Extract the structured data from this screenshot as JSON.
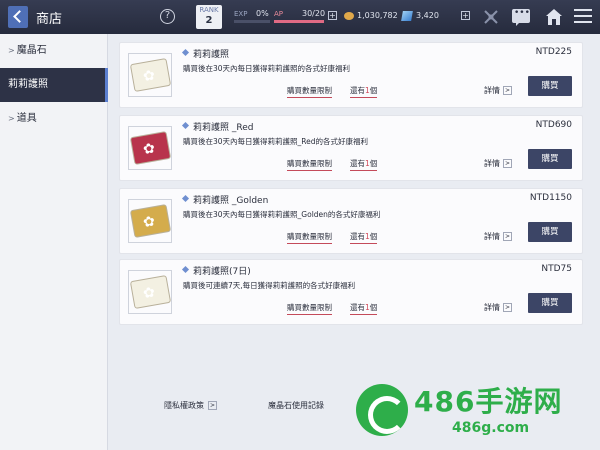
{
  "header": {
    "title": "商店",
    "help_glyph": "?",
    "rank_label": "RANK",
    "rank_value": "2",
    "exp_label": "EXP",
    "exp_value": "0%",
    "exp_progress": 0,
    "ap_label": "AP",
    "ap_value": "30/20",
    "ap_progress": 1,
    "plus_glyph": "+",
    "coins": "1,030,782",
    "gems": "3,420"
  },
  "sidebar": {
    "items": [
      {
        "label": "魔晶石",
        "has_caret": true
      },
      {
        "label": "莉莉護照",
        "has_caret": false,
        "active": true
      },
      {
        "label": "道具",
        "has_caret": true
      }
    ]
  },
  "products": [
    {
      "name": "莉莉護照",
      "price": "NTD225",
      "description": "購買後在30天內每日獲得莉莉護照的各式好康福利",
      "limit_label": "購買數量限制",
      "remaining_prefix": "還有",
      "remaining_count": "1",
      "remaining_suffix": "個",
      "detail_label": "詳情",
      "buy_label": "購買",
      "card_color": "#f3f0e2"
    },
    {
      "name": "莉莉護照 _Red",
      "price": "NTD690",
      "description": "購買後在30天內每日獲得莉莉護照_Red的各式好康福利",
      "limit_label": "購買數量限制",
      "remaining_prefix": "還有",
      "remaining_count": "1",
      "remaining_suffix": "個",
      "detail_label": "詳情",
      "buy_label": "購買",
      "card_color": "#b8344c"
    },
    {
      "name": "莉莉護照 _Golden",
      "price": "NTD1150",
      "description": "購買後在30天內每日獲得莉莉護照_Golden的各式好康福利",
      "limit_label": "購買數量限制",
      "remaining_prefix": "還有",
      "remaining_count": "1",
      "remaining_suffix": "個",
      "detail_label": "詳情",
      "buy_label": "購買",
      "card_color": "#d4ac4c"
    },
    {
      "name": "莉莉護照(7日)",
      "price": "NTD75",
      "description": "購買後可連續7天,每日獲得莉莉護照的各式好康福利",
      "limit_label": "購買數量限制",
      "remaining_prefix": "還有",
      "remaining_count": "1",
      "remaining_suffix": "個",
      "detail_label": "詳情",
      "buy_label": "購買",
      "card_color": "#f3f0e2"
    }
  ],
  "arrow_glyph": ">",
  "footer": {
    "privacy_label": "隱私權政策",
    "gem_usage_label": "魔晶石使用記錄"
  },
  "watermark": {
    "big": "486手游网",
    "small": "486g.com"
  }
}
